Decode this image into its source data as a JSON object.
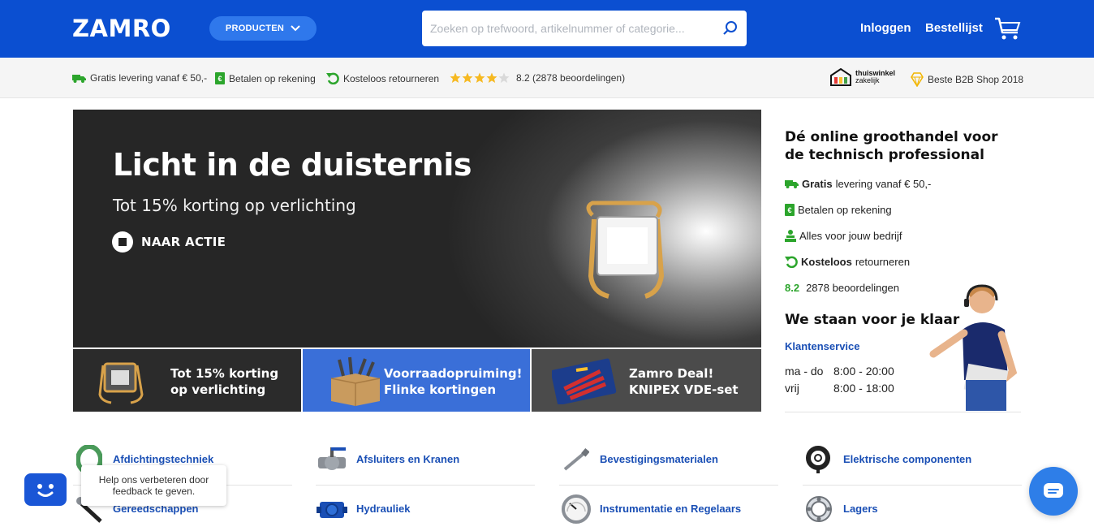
{
  "header": {
    "logo": "ZAMRO",
    "products_label": "PRODUCTEN",
    "search_placeholder": "Zoeken op trefwoord, artikelnummer of categorie...",
    "login_label": "Inloggen",
    "orderlist_label": "Bestellijst",
    "colors": {
      "primary": "#0b4fd1",
      "button": "#2f78ec"
    }
  },
  "usp_bar": {
    "items": [
      {
        "icon": "truck-icon",
        "text": "Gratis levering vanaf € 50,-"
      },
      {
        "icon": "invoice-icon",
        "text": "Betalen op rekening"
      },
      {
        "icon": "return-icon",
        "text": "Kosteloos retourneren"
      }
    ],
    "rating": {
      "stars_filled": 4,
      "stars_total": 5,
      "text": "8.2 (2878 beoordelingen)"
    },
    "badges": [
      {
        "icon": "thuiswinkel-logo",
        "line1": "thuiswinkel",
        "line2": "zakelijk"
      },
      {
        "icon": "diamond-icon",
        "text": "Beste B2B Shop 2018"
      }
    ]
  },
  "hero": {
    "title": "Licht in de duisternis",
    "subtitle": "Tot 15% korting op verlichting",
    "cta": "NAAR ACTIE"
  },
  "tiles": [
    {
      "line1": "Tot 15% korting",
      "line2": "op verlichting",
      "bg": "#2b2b2b"
    },
    {
      "line1": "Voorraadopruiming!",
      "line2": "Flinke kortingen",
      "bg": "#3a6fd8"
    },
    {
      "line1": "Zamro Deal!",
      "line2": "KNIPEX VDE-set",
      "bg": "#4b4b4b"
    }
  ],
  "info": {
    "title": "Dé online groothandel voor de technisch professional",
    "rows": [
      {
        "icon": "truck-icon",
        "bold": "Gratis",
        "text": "levering vanaf € 50,-"
      },
      {
        "icon": "invoice-icon",
        "bold": "",
        "text": "Betalen op rekening"
      },
      {
        "icon": "stack-icon",
        "bold": "",
        "text": "Alles voor jouw bedrijf"
      },
      {
        "icon": "return-icon",
        "bold": "Kosteloos",
        "text": "retourneren"
      }
    ],
    "score": "8.2",
    "reviews": "2878 beoordelingen",
    "service_title": "We staan voor je klaar",
    "service_link": "Klantenservice",
    "hours": [
      {
        "days": "ma - do",
        "time": "8:00 - 20:00"
      },
      {
        "days": "vrij",
        "time": "8:00 - 18:00"
      }
    ]
  },
  "categories": [
    {
      "name": "Afdichtingstechniek",
      "icon": "seal-ring-icon"
    },
    {
      "name": "Afsluiters en Kranen",
      "icon": "valve-icon"
    },
    {
      "name": "Bevestigingsmaterialen",
      "icon": "screw-icon"
    },
    {
      "name": "Elektrische componenten",
      "icon": "cable-icon"
    },
    {
      "name": "Gereedschappen",
      "icon": "tool-icon"
    },
    {
      "name": "Hydrauliek",
      "icon": "pump-icon"
    },
    {
      "name": "Instrumentatie en Regelaars",
      "icon": "gauge-icon"
    },
    {
      "name": "Lagers",
      "icon": "bearing-icon"
    }
  ],
  "feedback": {
    "text_line1": "Help ons verbeteren door",
    "text_line2": "feedback te geven."
  }
}
